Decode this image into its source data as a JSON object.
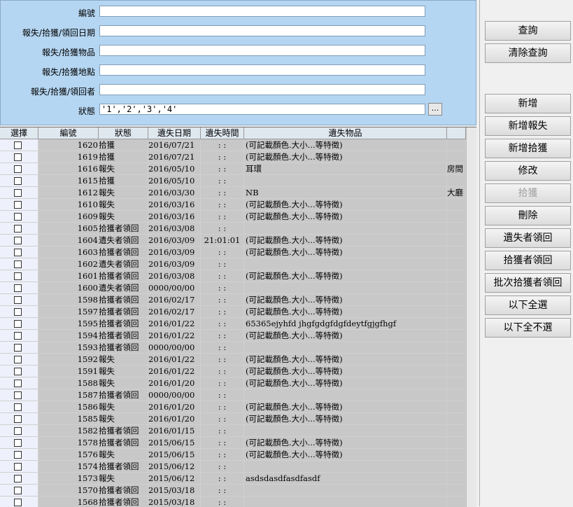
{
  "search": {
    "fields": [
      {
        "label": "編號",
        "value": ""
      },
      {
        "label": "報失/拾獲/領回日期",
        "value": ""
      },
      {
        "label": "報失/拾獲物品",
        "value": ""
      },
      {
        "label": "報失/拾獲地點",
        "value": ""
      },
      {
        "label": "報失/拾獲/領回者",
        "value": ""
      },
      {
        "label": "狀態",
        "value": "'1','2','3','4'"
      }
    ],
    "ellipsis_label": "..."
  },
  "buttons": [
    {
      "label": "查詢",
      "enabled": true
    },
    {
      "label": "清除查詢",
      "enabled": true
    },
    {
      "label": "新增",
      "enabled": true
    },
    {
      "label": "新增報失",
      "enabled": true
    },
    {
      "label": "新增拾獲",
      "enabled": true
    },
    {
      "label": "修改",
      "enabled": true
    },
    {
      "label": "拾獲",
      "enabled": false
    },
    {
      "label": "刪除",
      "enabled": true
    },
    {
      "label": "遺失者領回",
      "enabled": true
    },
    {
      "label": "拾獲者領回",
      "enabled": true
    },
    {
      "label": "批次拾獲者領回",
      "enabled": true
    },
    {
      "label": "以下全選",
      "enabled": true
    },
    {
      "label": "以下全不選",
      "enabled": true
    }
  ],
  "grid": {
    "columns": [
      "選擇",
      "編號",
      "狀態",
      "遺失日期",
      "遺失時間",
      "遺失物品"
    ],
    "rows": [
      {
        "id": "1620",
        "status": "拾獲",
        "date": "2016/07/21",
        "time": ":  :",
        "item": "(可記載顏色.大小...等特徵)",
        "extra": ""
      },
      {
        "id": "1619",
        "status": "拾獲",
        "date": "2016/07/21",
        "time": ":  :",
        "item": "(可記載顏色.大小...等特徵)",
        "extra": ""
      },
      {
        "id": "1616",
        "status": "報失",
        "date": "2016/05/10",
        "time": ":  :",
        "item": "耳環",
        "extra": "房間"
      },
      {
        "id": "1615",
        "status": "拾獲",
        "date": "2016/05/10",
        "time": ":  :",
        "item": "",
        "extra": ""
      },
      {
        "id": "1612",
        "status": "報失",
        "date": "2016/03/30",
        "time": ":  :",
        "item": "NB",
        "extra": "大廳"
      },
      {
        "id": "1610",
        "status": "報失",
        "date": "2016/03/16",
        "time": ":  :",
        "item": "(可記載顏色.大小...等特徵)",
        "extra": ""
      },
      {
        "id": "1609",
        "status": "報失",
        "date": "2016/03/16",
        "time": ":  :",
        "item": "(可記載顏色.大小...等特徵)",
        "extra": ""
      },
      {
        "id": "1605",
        "status": "拾獲者領回",
        "date": "2016/03/08",
        "time": ":  :",
        "item": "",
        "extra": ""
      },
      {
        "id": "1604",
        "status": "遺失者領回",
        "date": "2016/03/09",
        "time": "21:01:01",
        "item": "(可記載顏色.大小...等特徵)",
        "extra": ""
      },
      {
        "id": "1603",
        "status": "拾獲者領回",
        "date": "2016/03/09",
        "time": ":  :",
        "item": "(可記載顏色.大小...等特徵)",
        "extra": ""
      },
      {
        "id": "1602",
        "status": "遺失者領回",
        "date": "2016/03/09",
        "time": ":  :",
        "item": "",
        "extra": ""
      },
      {
        "id": "1601",
        "status": "拾獲者領回",
        "date": "2016/03/08",
        "time": ":  :",
        "item": "(可記載顏色.大小...等特徵)",
        "extra": ""
      },
      {
        "id": "1600",
        "status": "遺失者領回",
        "date": "0000/00/00",
        "time": ":  :",
        "item": "",
        "extra": ""
      },
      {
        "id": "1598",
        "status": "拾獲者領回",
        "date": "2016/02/17",
        "time": ":  :",
        "item": "(可記載顏色.大小...等特徵)",
        "extra": ""
      },
      {
        "id": "1597",
        "status": "拾獲者領回",
        "date": "2016/02/17",
        "time": ":  :",
        "item": "(可記載顏色.大小...等特徵)",
        "extra": ""
      },
      {
        "id": "1595",
        "status": "拾獲者領回",
        "date": "2016/01/22",
        "time": ":  :",
        "item": "65365ejyhfd  jhgfgdgfdgfdeytfgjgfhgf",
        "extra": ""
      },
      {
        "id": "1594",
        "status": "拾獲者領回",
        "date": "2016/01/22",
        "time": ":  :",
        "item": "(可記載顏色.大小...等特徵)",
        "extra": ""
      },
      {
        "id": "1593",
        "status": "拾獲者領回",
        "date": "0000/00/00",
        "time": ":  :",
        "item": "",
        "extra": ""
      },
      {
        "id": "1592",
        "status": "報失",
        "date": "2016/01/22",
        "time": ":  :",
        "item": "(可記載顏色.大小...等特徵)",
        "extra": ""
      },
      {
        "id": "1591",
        "status": "報失",
        "date": "2016/01/22",
        "time": ":  :",
        "item": "(可記載顏色.大小...等特徵)",
        "extra": ""
      },
      {
        "id": "1588",
        "status": "報失",
        "date": "2016/01/20",
        "time": ":  :",
        "item": "(可記載顏色.大小...等特徵)",
        "extra": ""
      },
      {
        "id": "1587",
        "status": "拾獲者領回",
        "date": "0000/00/00",
        "time": ":  :",
        "item": "",
        "extra": ""
      },
      {
        "id": "1586",
        "status": "報失",
        "date": "2016/01/20",
        "time": ":  :",
        "item": "(可記載顏色.大小...等特徵)",
        "extra": ""
      },
      {
        "id": "1585",
        "status": "報失",
        "date": "2016/01/20",
        "time": ":  :",
        "item": "(可記載顏色.大小...等特徵)",
        "extra": ""
      },
      {
        "id": "1582",
        "status": "拾獲者領回",
        "date": "2016/01/15",
        "time": ":  :",
        "item": "",
        "extra": ""
      },
      {
        "id": "1578",
        "status": "拾獲者領回",
        "date": "2015/06/15",
        "time": ":  :",
        "item": "(可記載顏色.大小...等特徵)",
        "extra": ""
      },
      {
        "id": "1576",
        "status": "報失",
        "date": "2015/06/15",
        "time": ":  :",
        "item": "(可記載顏色.大小...等特徵)",
        "extra": ""
      },
      {
        "id": "1574",
        "status": "拾獲者領回",
        "date": "2015/06/12",
        "time": ":  :",
        "item": "",
        "extra": ""
      },
      {
        "id": "1573",
        "status": "報失",
        "date": "2015/06/12",
        "time": ":  :",
        "item": "asdsdasdfasdfasdf",
        "extra": ""
      },
      {
        "id": "1570",
        "status": "拾獲者領回",
        "date": "2015/03/18",
        "time": ":  :",
        "item": "",
        "extra": ""
      },
      {
        "id": "1568",
        "status": "拾獲者領回",
        "date": "2015/03/18",
        "time": ":  :",
        "item": "",
        "extra": ""
      }
    ]
  }
}
